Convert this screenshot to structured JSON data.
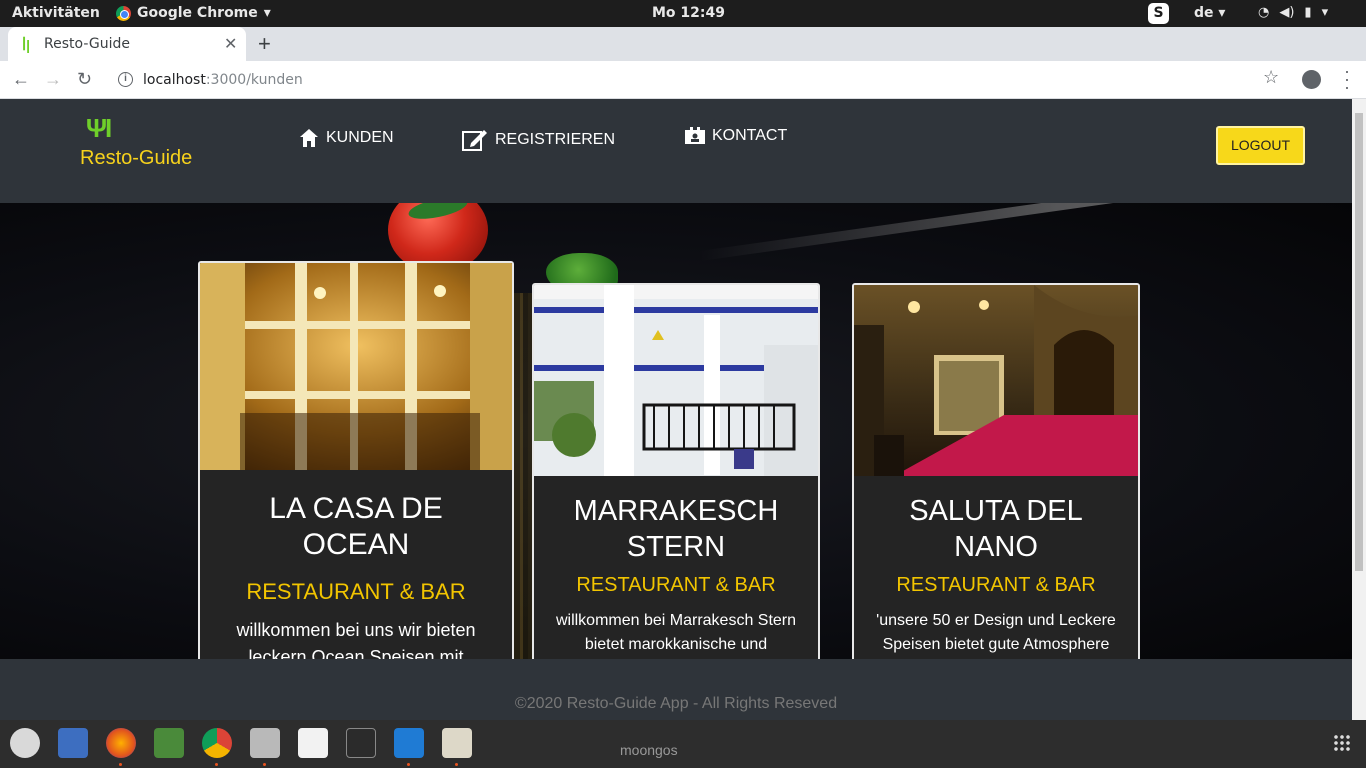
{
  "system": {
    "activities": "Aktivitäten",
    "app_name": "Google Chrome",
    "clock": "Mo 12:49",
    "skype_letter": "S",
    "language": "de"
  },
  "browser": {
    "tab_title": "Resto-Guide",
    "url_host": "localhost",
    "url_path": ":3000/kunden"
  },
  "header": {
    "brand": "Resto-Guide",
    "nav": [
      {
        "label": "KUNDEN",
        "icon": "home-icon"
      },
      {
        "label": "REGISTRIEREN",
        "icon": "edit-icon"
      },
      {
        "label": "KONTACT",
        "icon": "contact-card-icon"
      }
    ],
    "logout": "LOGOUT"
  },
  "restaurants": [
    {
      "name_line1": "LA CASA DE",
      "name_line2": "OCEAN",
      "subtitle": "RESTAURANT & BAR",
      "desc_line1": "willkommen bei uns wir bieten",
      "desc_line2": "leckern Ocean Speisen mit"
    },
    {
      "name_line1": "MARRAKESCH",
      "name_line2": "STERN",
      "subtitle": "RESTAURANT & BAR",
      "desc_line1": "willkommen bei Marrakesch Stern",
      "desc_line2": "bietet marokkanische und"
    },
    {
      "name_line1": "SALUTA DEL",
      "name_line2": "NANO",
      "subtitle": "RESTAURANT & BAR",
      "desc_line1": "'unsere 50 er Design und Leckere",
      "desc_line2": "Speisen bietet gute Atmosphere"
    }
  ],
  "footer": {
    "copyright": "©2020 Resto-Guide App - All Rights Reseved"
  },
  "dock": {
    "label": "moongos"
  },
  "colors": {
    "accent_yellow": "#f7d21c",
    "header_bg": "#2f343a",
    "card_bg": "#242424",
    "brand_green": "#6fcf2a"
  }
}
